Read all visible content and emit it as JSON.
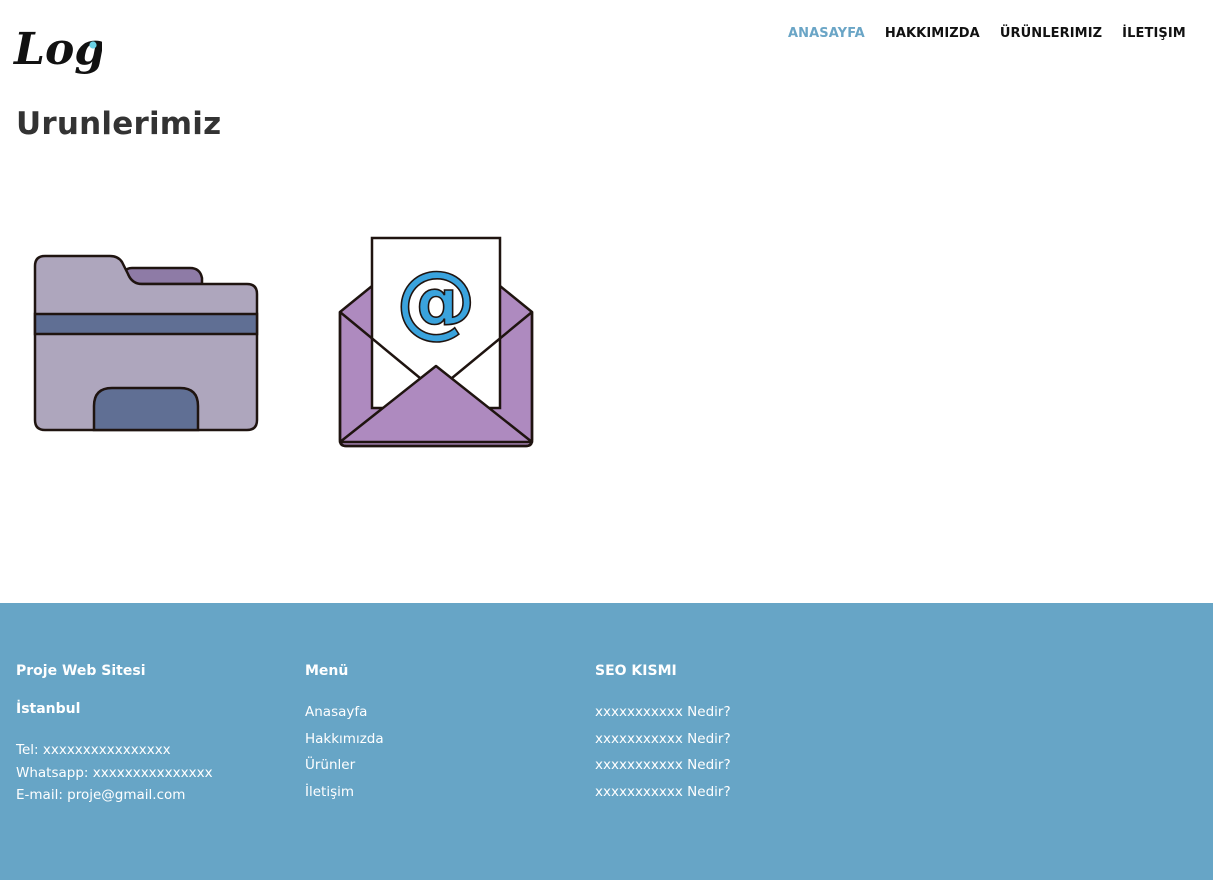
{
  "header": {
    "logo_text": "Logo",
    "nav": [
      {
        "label": "ANASAYFA",
        "active": true
      },
      {
        "label": "HAKKIMIZDA",
        "active": false
      },
      {
        "label": "ÜRÜNLERIMIZ",
        "active": false
      },
      {
        "label": "İLETIŞIM",
        "active": false
      }
    ]
  },
  "main": {
    "title": "Urunlerimiz",
    "products": [
      {
        "icon": "folder-icon"
      },
      {
        "icon": "email-envelope-icon"
      }
    ]
  },
  "footer": {
    "site": {
      "title": "Proje Web Sitesi",
      "city": "İstanbul",
      "tel": "Tel: xxxxxxxxxxxxxxxx",
      "whatsapp": "Whatsapp: xxxxxxxxxxxxxxx",
      "email": "E-mail: proje@gmail.com"
    },
    "menu": {
      "title": "Menü",
      "links": [
        "Anasayfa",
        "Hakkımızda",
        "Ürünler",
        "İletişim"
      ]
    },
    "seo": {
      "title": "SEO KISMI",
      "links": [
        "xxxxxxxxxxx Nedir?",
        "xxxxxxxxxxx Nedir?",
        "xxxxxxxxxxx Nedir?",
        "xxxxxxxxxxx Nedir?"
      ]
    }
  },
  "colors": {
    "accent": "#6aa5c6",
    "footer_bg": "#67a5c6",
    "text": "#333333"
  }
}
